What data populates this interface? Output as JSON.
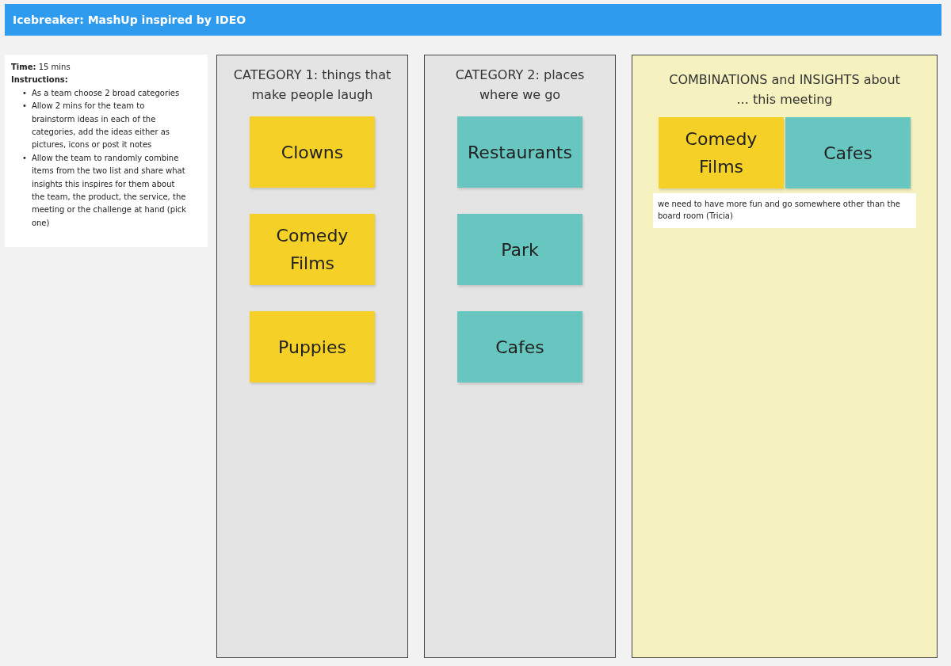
{
  "header": {
    "title": "Icebreaker: MashUp inspired by IDEO"
  },
  "info": {
    "time_label": "Time:",
    "time_value": "15 mins",
    "instructions_label": "Instructions:",
    "steps": [
      {
        "bullet": "•",
        "text": "As a team choose 2 broad categories"
      },
      {
        "bullet": "•",
        "text": "Allow 2 mins for the team to brainstorm ideas in each of the categories, add the ideas either as pictures, icons or post it notes"
      },
      {
        "bullet": "•",
        "text": "Allow the team to randomly combine items from the two list and share what insights this inspires for them about the team, the product, the service, the meeting or the challenge at hand (pick one)"
      }
    ]
  },
  "categories": [
    {
      "title": "CATEGORY 1: things that make people laugh",
      "notes": [
        {
          "text": "Clowns",
          "color": "#f5d027"
        },
        {
          "text": "Comedy Films",
          "color": "#f5d027"
        },
        {
          "text": "Puppies",
          "color": "#f5d027"
        }
      ]
    },
    {
      "title": "CATEGORY 2: places where we go",
      "notes": [
        {
          "text": "Restaurants",
          "color": "#67c6c0"
        },
        {
          "text": "Park",
          "color": "#67c6c0"
        },
        {
          "text": "Cafes",
          "color": "#67c6c0"
        }
      ]
    }
  ],
  "combinations": {
    "title": "COMBINATIONS and INSIGHTS about ... this meeting",
    "notes": [
      {
        "text": "Comedy Films",
        "color": "#f5d027"
      },
      {
        "text": "Cafes",
        "color": "#67c6c0"
      }
    ],
    "insight": "we need to have more fun and go somewhere other than the board room (Tricia)"
  }
}
